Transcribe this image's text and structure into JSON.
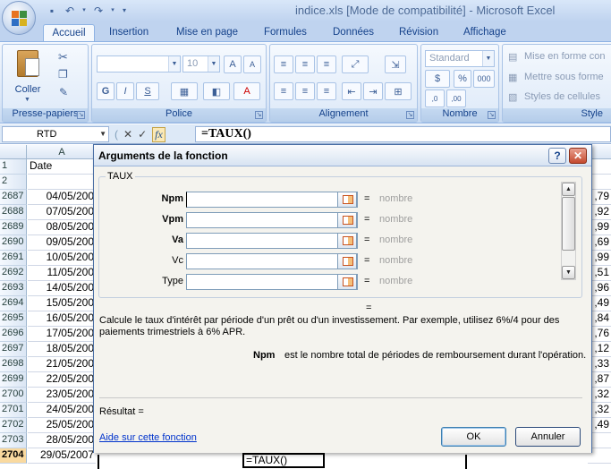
{
  "window": {
    "title": "indice.xls  [Mode de compatibilité] - Microsoft Excel"
  },
  "tabs": [
    "Accueil",
    "Insertion",
    "Mise en page",
    "Formules",
    "Données",
    "Révision",
    "Affichage"
  ],
  "ribbon": {
    "clipboard": {
      "paste_label": "Coller",
      "group_label": "Presse-papiers"
    },
    "font": {
      "font_name": "",
      "font_size": "10",
      "group_label": "Police",
      "bold": "G",
      "italic": "I",
      "underline": "S"
    },
    "alignment": {
      "group_label": "Alignement"
    },
    "number": {
      "format": "Standard",
      "percent": "%",
      "thousands": "000",
      "group_label": "Nombre"
    },
    "style": {
      "conditional": "Mise en forme con",
      "table": "Mettre sous forme",
      "cell_styles": "Styles de cellules",
      "group_label": "Style"
    }
  },
  "formula_bar": {
    "name_box": "RTD",
    "formula": "=TAUX()"
  },
  "grid": {
    "col_a_header": "A",
    "rows": [
      {
        "num": "1",
        "a": "Date",
        "r": ""
      },
      {
        "num": "2",
        "a": "",
        "r": ""
      },
      {
        "num": "2687",
        "a": "04/05/200",
        "r": ",79"
      },
      {
        "num": "2688",
        "a": "07/05/200",
        "r": ",92"
      },
      {
        "num": "2689",
        "a": "08/05/200",
        "r": ",99"
      },
      {
        "num": "2690",
        "a": "09/05/200",
        "r": ",69"
      },
      {
        "num": "2691",
        "a": "10/05/200",
        "r": ",99"
      },
      {
        "num": "2692",
        "a": "11/05/200",
        "r": ",51"
      },
      {
        "num": "2693",
        "a": "14/05/200",
        "r": ",96"
      },
      {
        "num": "2694",
        "a": "15/05/200",
        "r": ",49"
      },
      {
        "num": "2695",
        "a": "16/05/200",
        "r": ",84"
      },
      {
        "num": "2696",
        "a": "17/05/200",
        "r": ",76"
      },
      {
        "num": "2697",
        "a": "18/05/200",
        "r": ",12"
      },
      {
        "num": "2698",
        "a": "21/05/200",
        "r": ",33"
      },
      {
        "num": "2699",
        "a": "22/05/200",
        "r": ",87"
      },
      {
        "num": "2700",
        "a": "23/05/200",
        "r": ",32"
      },
      {
        "num": "2701",
        "a": "24/05/200",
        "r": ",32"
      },
      {
        "num": "2702",
        "a": "25/05/200",
        "r": ",49"
      },
      {
        "num": "2703",
        "a": "28/05/200",
        "r": ""
      },
      {
        "num": "2704",
        "a": "29/05/2007",
        "r": ""
      }
    ],
    "active_cell_value": "=TAUX()"
  },
  "dialog": {
    "title": "Arguments de la fonction",
    "function_name": "TAUX",
    "arguments": [
      {
        "label": "Npm",
        "required": true,
        "hint": "nombre",
        "value": ""
      },
      {
        "label": "Vpm",
        "required": true,
        "hint": "nombre",
        "value": ""
      },
      {
        "label": "Va",
        "required": true,
        "hint": "nombre",
        "value": ""
      },
      {
        "label": "Vc",
        "required": false,
        "hint": "nombre",
        "value": ""
      },
      {
        "label": "Type",
        "required": false,
        "hint": "nombre",
        "value": ""
      }
    ],
    "equals": "=",
    "description": "Calcule le taux d'intérêt par période d'un prêt ou d'un investissement. Par exemple, utilisez 6%/4 pour des paiements trimestriels à 6% APR.",
    "arg_help_name": "Npm",
    "arg_help_text": "est le nombre total de périodes de remboursement durant l'opération.",
    "result_label": "Résultat =",
    "help_link": "Aide sur cette fonction",
    "ok_label": "OK",
    "cancel_label": "Annuler",
    "help_button": "?",
    "close_button": "✕"
  }
}
